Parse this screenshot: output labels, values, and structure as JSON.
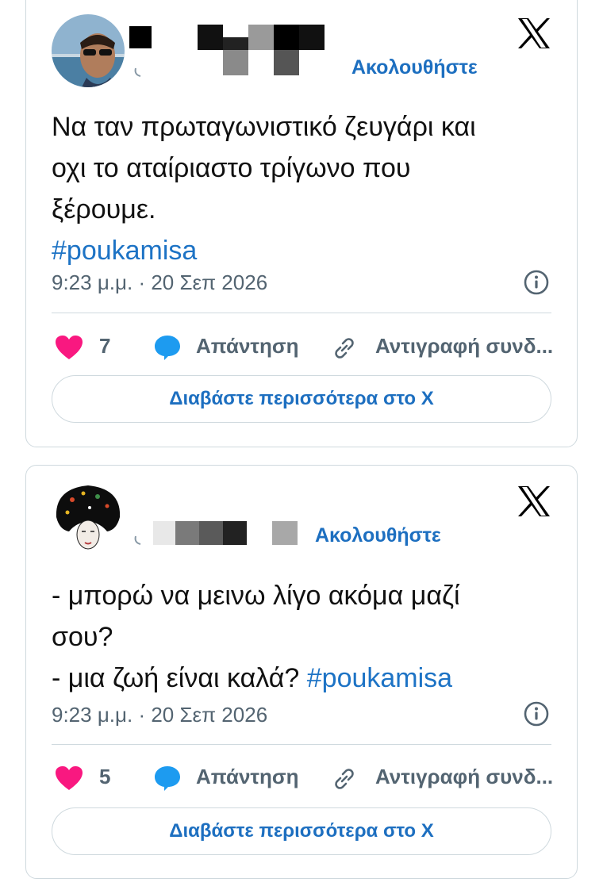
{
  "tweets": [
    {
      "follow_label": "Ακολουθήστε",
      "text_line1": "Να ταν πρωταγωνιστικό ζευγάρι και",
      "text_line2": "οχι το αταίριαστο τρίγωνο που",
      "text_line3": "ξέρουμε.",
      "hashtag": "#poukamisa",
      "timestamp": "9:23 μ.μ. · 20 Σεπ 2026",
      "likes": "7",
      "reply_label": "Απάντηση",
      "copy_label": "Αντιγραφή συνδ...",
      "read_more": "Διαβάστε περισσότερα στο X"
    },
    {
      "follow_label": "Ακολουθήστε",
      "text_line1": "- μπορώ να μεινω λίγο ακόμα μαζί",
      "text_line2": "σου?",
      "text_line3": "- μια ζωή είναι καλά?",
      "hashtag": "#poukamisa",
      "timestamp": "9:23 μ.μ. · 20 Σεπ 2026",
      "likes": "5",
      "reply_label": "Απάντηση",
      "copy_label": "Αντιγραφή συνδ...",
      "read_more": "Διαβάστε περισσότερα στο X"
    }
  ],
  "colors": {
    "link": "#1d6fc0",
    "heart": "#f91880",
    "reply_bubble": "#1d9bf0",
    "muted": "#536471",
    "border": "#cfd9de"
  },
  "icons": [
    "x-logo-icon",
    "info-icon",
    "heart-icon",
    "reply-bubble-icon",
    "link-icon"
  ]
}
